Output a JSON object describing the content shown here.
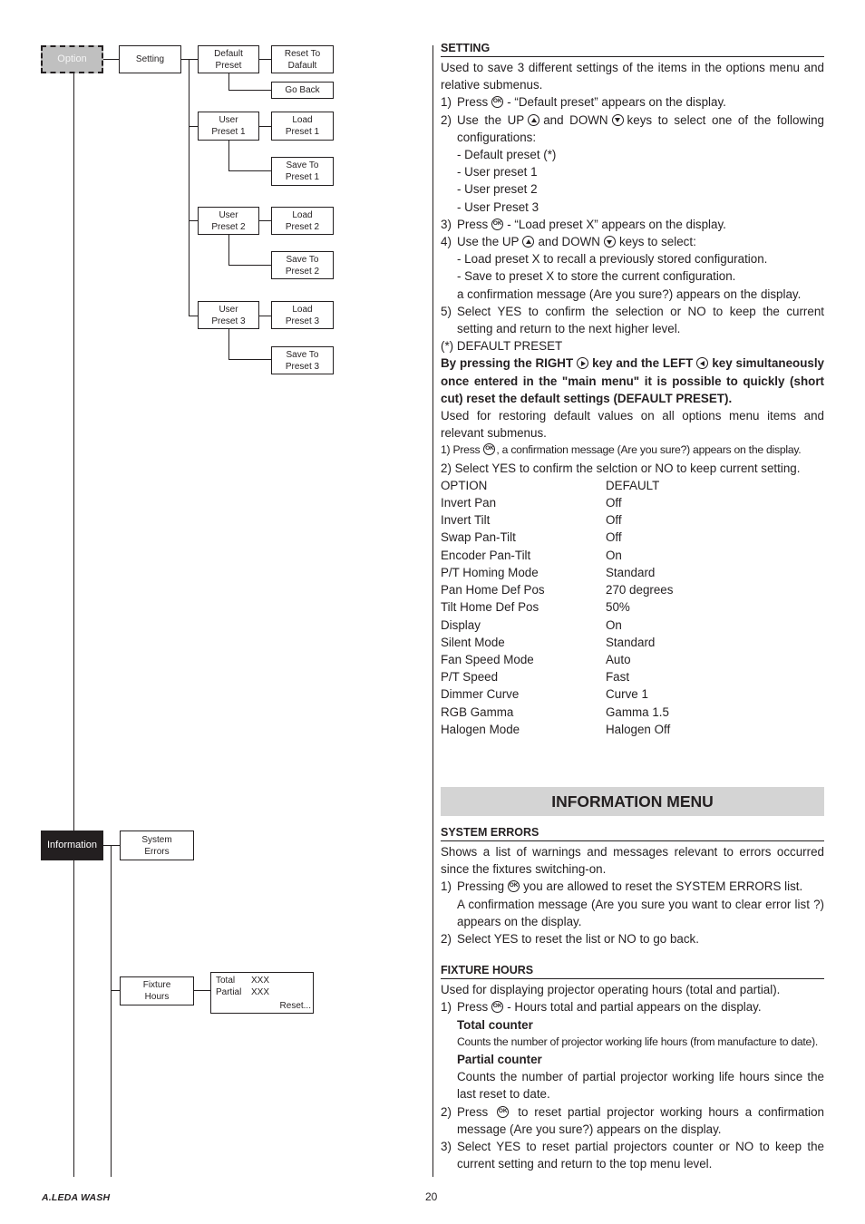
{
  "diagram": {
    "option": "Option",
    "setting": "Setting",
    "default_preset": "Default\nPreset",
    "reset_to_default": "Reset To\nDafault",
    "go_back": "Go Back",
    "user_presets": [
      {
        "label": "User\nPreset 1",
        "load": "Load\nPreset 1",
        "save": "Save To\nPreset 1"
      },
      {
        "label": "User\nPreset 2",
        "load": "Load\nPreset 2",
        "save": "Save To\nPreset 2"
      },
      {
        "label": "User\nPreset 3",
        "load": "Load\nPreset 3",
        "save": "Save To\nPreset 3"
      }
    ],
    "information": "Information",
    "system_errors": "System\nErrors",
    "fixture_hours": "Fixture\nHours",
    "fixture_display": {
      "total_label": "Total",
      "total_value": "XXX",
      "partial_label": "Partial",
      "partial_value": "XXX",
      "reset": "Reset..."
    }
  },
  "setting": {
    "title": "SETTING",
    "intro": "Used to save 3 different settings of the items in the options menu and relative submenus.",
    "step1_num": "1)",
    "step1_a": "Press",
    "step1_b": "- “Default preset” appears on the display.",
    "step2_num": "2)",
    "step2_a": "Use the UP",
    "step2_b": "and DOWN",
    "step2_c": "keys to select one of the following configurations:",
    "configs": [
      "- Default preset (*)",
      "- User preset 1",
      "- User preset 2",
      "- User Preset 3"
    ],
    "step3_num": "3)",
    "step3_a": "Press",
    "step3_b": "- “Load preset X” appears on the display.",
    "step4_num": "4)",
    "step4_a": "Use the UP",
    "step4_b": "and DOWN",
    "step4_c": "keys to select:",
    "step4_items": [
      "- Load preset X to recall a previously stored configuration.",
      "- Save to preset X to store the current configuration.",
      "a confirmation message (Are you sure?) appears on the display."
    ],
    "step5_num": "5)",
    "step5": "Select YES to confirm the selection or NO to keep the current setting and return to the next higher level.",
    "default_heading": "(*) DEFAULT PRESET",
    "shortcut_a": "By pressing the RIGHT",
    "shortcut_b": "key and the LEFT",
    "shortcut_c": "key simultaneously once entered in the \"main menu\" it is possible to quickly (short cut) reset the default settings (DEFAULT PRESET).",
    "restore_text": "Used for restoring default values on all options menu items and relevant submenus.",
    "r1_a": "1) Press",
    "r1_b": ", a confirmation message (Are you sure?) appears on the display.",
    "r2": "2) Select YES to confirm the selction or NO to keep current setting."
  },
  "defaults_table": {
    "headers": [
      "OPTION",
      "DEFAULT"
    ],
    "rows": [
      [
        "Invert Pan",
        "Off"
      ],
      [
        "Invert Tilt",
        "Off"
      ],
      [
        "Swap Pan-Tilt",
        "Off"
      ],
      [
        "Encoder Pan-Tilt",
        "On"
      ],
      [
        "P/T Homing Mode",
        "Standard"
      ],
      [
        "Pan Home Def Pos",
        "270 degrees"
      ],
      [
        "Tilt Home Def Pos",
        "50%"
      ],
      [
        "Display",
        "On"
      ],
      [
        "Silent Mode",
        "Standard"
      ],
      [
        "Fan Speed Mode",
        "Auto"
      ],
      [
        "P/T Speed",
        "Fast"
      ],
      [
        "Dimmer Curve",
        "Curve 1"
      ],
      [
        "RGB Gamma",
        "Gamma 1.5"
      ],
      [
        "Halogen Mode",
        "Halogen Off"
      ]
    ]
  },
  "information_menu": {
    "banner": "INFORMATION MENU",
    "system_errors": {
      "title": "SYSTEM ERRORS",
      "intro": "Shows a list of warnings and messages relevant to errors occurred since the fixtures switching-on.",
      "s1_num": "1)",
      "s1_a": "Pressing",
      "s1_b": "you are allowed to reset the SYSTEM ERRORS list.",
      "s1_c": "A confirmation message (Are you sure you want to clear error list ?) appears on the display.",
      "s2_num": "2)",
      "s2": "Select YES to reset the list or NO to go back."
    },
    "fixture_hours": {
      "title": "FIXTURE HOURS",
      "intro": "Used for displaying projector operating hours (total and partial).",
      "s1_num": "1)",
      "s1_a": "Press",
      "s1_b": "- Hours total and partial appears on the display.",
      "total_heading": "Total counter",
      "total_text": "Counts the number of projector working life hours (from manufacture to date).",
      "partial_heading": "Partial counter",
      "partial_text": "Counts the number of partial projector working life hours since the last reset to date.",
      "s2_num": "2)",
      "s2_a": "Press",
      "s2_b": "to reset partial projector working hours a confirmation message (Are you sure?) appears on the display.",
      "s3_num": "3)",
      "s3": "Select YES to reset partial projectors counter or NO to keep the current setting and return to the top menu level."
    }
  },
  "footer": {
    "brand": "A.LEDA WASH",
    "page": "20"
  }
}
